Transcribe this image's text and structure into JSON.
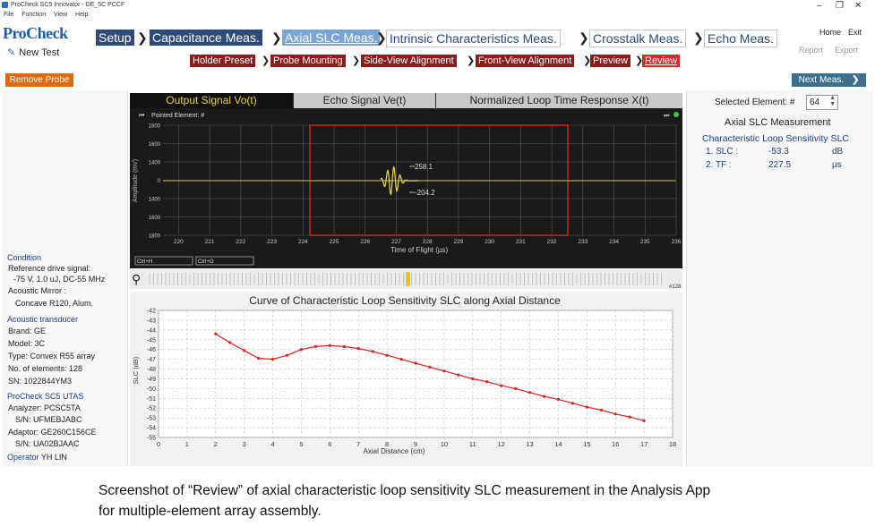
{
  "window": {
    "title": "ProCheck SC5 Innovator - DE_5C PCCF"
  },
  "menu": [
    "File",
    "Function",
    "View",
    "Help"
  ],
  "brand": "ProCheck",
  "new_test": "New Test",
  "nav": {
    "steps": [
      "Setup",
      "Capacitance Meas.",
      "Axial SLC Meas.",
      "Intrinsic Characteristics Meas.",
      "Crosstalk Meas.",
      "Echo Meas."
    ],
    "home": "Home",
    "exit": "Exit",
    "report": "Report",
    "export": "Export"
  },
  "substeps": [
    "Holder Preset",
    "Probe Mounting",
    "Side-View Alignment",
    "Front-View Alignment",
    "Preview",
    "Review"
  ],
  "remove_probe": "Remove Probe",
  "next_meas": "Next Meas.",
  "left": {
    "condition_h": "Condition",
    "ref_drive_label": "Reference drive signal:",
    "ref_drive_value": "-75 V,  1.0 uJ,  DC-55 MHz",
    "mirror_label": "Acoustic Mirror :",
    "mirror_value": "Concave R120, Alum.",
    "transducer_h": "Acoustic transducer",
    "brand": "Brand: GE",
    "model": "Model: 3C",
    "type": "Type: Convex R55 array",
    "elements": "No. of elements: 128",
    "sn": "SN: 1022844YM3",
    "utas_h": "ProCheck SC5 UTAS",
    "analyzer": "Analyzer: PCSC5TA",
    "analyzer_sn": "S/N: UFMEBJABC",
    "adaptor": "Adaptor: GE260C156CE",
    "adaptor_sn": "S/N: UA02BJAAC",
    "operator_label": "Operator",
    "operator_value": "YH LIN"
  },
  "right": {
    "selected_label": "Selected Element: #",
    "selected_value": "64",
    "meas_title": "Axial SLC Measurement",
    "cls_title": "Characteristic Loop Sensitivity SLC",
    "r1_name": "1.  SLC :",
    "r1_val": "-53.3",
    "r1_unit": "dB",
    "r2_name": "2.  TF :",
    "r2_val": "227.5",
    "r2_unit": "µs"
  },
  "tabs": [
    "Output Signal Vo(t)",
    "Echo Signal Ve(t)",
    "Normalized Loop Time Response X(t)"
  ],
  "scope": {
    "pointed": "Pointed Element: #",
    "ylabel": "Amplitude (mV)",
    "xlabel": "Time of Flight (µs)",
    "yticks": [
      "1800",
      "1600",
      "1400",
      "0",
      "1400",
      "1600",
      "1800"
    ],
    "xticks": [
      "220",
      "221",
      "222",
      "223",
      "224",
      "225",
      "226",
      "227",
      "228",
      "229",
      "230",
      "231",
      "232",
      "233",
      "234",
      "235",
      "236"
    ],
    "peak_pos": "258.1",
    "peak_neg": "-204.2",
    "ctrl_a": "Ctrl+H",
    "ctrl_b": "Ctrl+O"
  },
  "element_bar": {
    "end_label": "#128"
  },
  "chart_data": {
    "type": "line",
    "title": "Curve of Characteristic Loop Sensitivity SLC along Axial Distance",
    "xlabel": "Axial Distance (cm)",
    "ylabel": "SLC (dB)",
    "xlim": [
      0,
      18
    ],
    "ylim": [
      -55,
      -42
    ],
    "xticks": [
      0,
      1,
      2,
      3,
      4,
      5,
      6,
      7,
      8,
      9,
      10,
      11,
      12,
      13,
      14,
      15,
      16,
      17,
      18
    ],
    "yticks": [
      -42,
      -43,
      -44,
      -45,
      -46,
      -47,
      -48,
      -49,
      -50,
      -51,
      -52,
      -53,
      -54,
      -55
    ],
    "grid": true,
    "color": "#e02020",
    "x": [
      2.0,
      2.5,
      3.0,
      3.5,
      4.0,
      4.5,
      5.0,
      5.5,
      6.0,
      6.5,
      7.0,
      7.5,
      8.0,
      8.5,
      9.0,
      9.5,
      10.0,
      10.5,
      11.0,
      11.5,
      12.0,
      12.5,
      13.0,
      13.5,
      14.0,
      14.5,
      15.0,
      15.5,
      16.0,
      16.5,
      17.0
    ],
    "y": [
      -44.4,
      -45.3,
      -46.1,
      -46.9,
      -47.0,
      -46.6,
      -46.0,
      -45.7,
      -45.6,
      -45.7,
      -45.9,
      -46.2,
      -46.6,
      -47.0,
      -47.4,
      -47.8,
      -48.2,
      -48.6,
      -49.0,
      -49.3,
      -49.7,
      -50.0,
      -50.4,
      -50.8,
      -51.1,
      -51.5,
      -51.9,
      -52.2,
      -52.6,
      -52.9,
      -53.3
    ]
  },
  "caption": {
    "line1": "Screenshot of “Review” of axial characteristic loop sensitivity SLC measurement in the Analysis App",
    "line2": "for multiple-element array assembly."
  }
}
